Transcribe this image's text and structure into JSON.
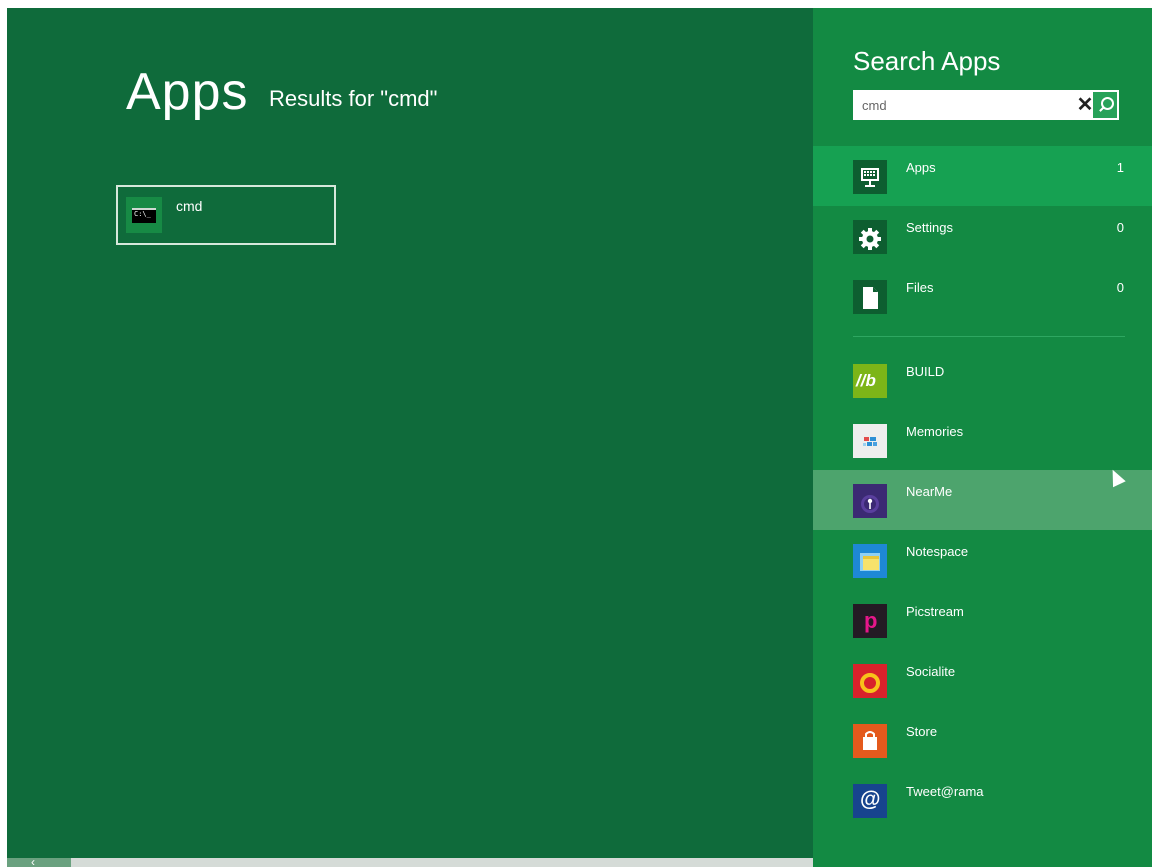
{
  "main": {
    "title": "Apps",
    "subtitle": "Results for \"cmd\"",
    "results": [
      {
        "label": "cmd",
        "icon": "command-prompt-icon",
        "icon_text": "C:\\_"
      }
    ]
  },
  "search_pane": {
    "title": "Search Apps",
    "query": "cmd",
    "clear_glyph": "✕",
    "categories": [
      {
        "label": "Apps",
        "count": "1",
        "icon": "keyboard-monitor-icon",
        "selected": true
      },
      {
        "label": "Settings",
        "count": "0",
        "icon": "gear-icon",
        "selected": false
      },
      {
        "label": "Files",
        "count": "0",
        "icon": "file-icon",
        "selected": false
      }
    ],
    "apps": [
      {
        "label": "BUILD",
        "icon": "build-icon",
        "icon_text": "//b",
        "color": "#7cb518"
      },
      {
        "label": "Memories",
        "icon": "memories-icon",
        "color": "#f0f0f0"
      },
      {
        "label": "NearMe",
        "icon": "nearme-icon",
        "color": "#3b2a73"
      },
      {
        "label": "Notespace",
        "icon": "notespace-icon",
        "color": "#1e88d6"
      },
      {
        "label": "Picstream",
        "icon": "picstream-icon",
        "icon_text": "p",
        "color": "#2a1c29"
      },
      {
        "label": "Socialite",
        "icon": "socialite-icon",
        "color": "#d8222b"
      },
      {
        "label": "Store",
        "icon": "store-icon",
        "color": "#e45a1d"
      },
      {
        "label": "Tweet@rama",
        "icon": "tweetarama-icon",
        "icon_text": "@",
        "color": "#17448e"
      }
    ]
  },
  "bottom_bar": {
    "back_glyph": "‹"
  }
}
